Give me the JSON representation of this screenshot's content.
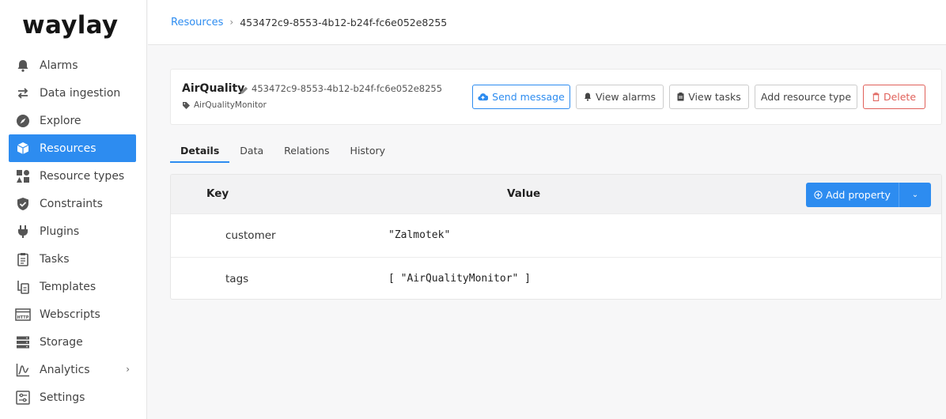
{
  "app": {
    "logo": "waylay"
  },
  "sidebar": {
    "items": [
      {
        "label": "Alarms",
        "icon": "bell-icon",
        "active": false
      },
      {
        "label": "Data ingestion",
        "icon": "arrows-left-right-icon",
        "active": false
      },
      {
        "label": "Explore",
        "icon": "compass-icon",
        "active": false
      },
      {
        "label": "Resources",
        "icon": "cubes-icon",
        "active": true
      },
      {
        "label": "Resource types",
        "icon": "shapes-icon",
        "active": false
      },
      {
        "label": "Constraints",
        "icon": "shield-check-icon",
        "active": false
      },
      {
        "label": "Plugins",
        "icon": "plug-icon",
        "active": false
      },
      {
        "label": "Tasks",
        "icon": "clipboard-icon",
        "active": false
      },
      {
        "label": "Templates",
        "icon": "template-icon",
        "active": false
      },
      {
        "label": "Webscripts",
        "icon": "http-window-icon",
        "active": false
      },
      {
        "label": "Storage",
        "icon": "storage-icon",
        "active": false
      },
      {
        "label": "Analytics",
        "icon": "chart-icon",
        "active": false,
        "expandable": true
      },
      {
        "label": "Settings",
        "icon": "sliders-icon",
        "active": false
      }
    ]
  },
  "breadcrumb": {
    "root": "Resources",
    "separator": "›",
    "current": "453472c9-8553-4b12-b24f-fc6e052e8255"
  },
  "resource": {
    "name": "AirQuality",
    "id": "453472c9-8553-4b12-b24f-fc6e052e8255",
    "tag": "AirQualityMonitor"
  },
  "actions": {
    "send_message": "Send message",
    "view_alarms": "View alarms",
    "view_tasks": "View tasks",
    "add_resource_type": "Add resource type",
    "delete": "Delete"
  },
  "tabs": [
    {
      "label": "Details",
      "active": true
    },
    {
      "label": "Data",
      "active": false
    },
    {
      "label": "Relations",
      "active": false
    },
    {
      "label": "History",
      "active": false
    }
  ],
  "table": {
    "headers": {
      "key": "Key",
      "value": "Value"
    },
    "add_property": "Add property",
    "rows": [
      {
        "key": "customer",
        "value": "\"Zalmotek\""
      },
      {
        "key": "tags",
        "value": "[ \"AirQualityMonitor\" ]"
      }
    ]
  },
  "colors": {
    "accent": "#2d8cf0",
    "danger": "#e0605a"
  }
}
